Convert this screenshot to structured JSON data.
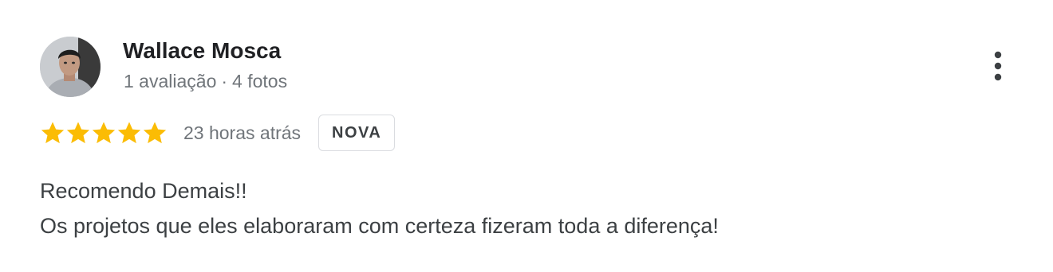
{
  "review": {
    "author": {
      "name": "Wallace Mosca",
      "reviews_count": "1 avaliação",
      "separator": "·",
      "photos_count": "4 fotos",
      "avatar_icon": "person-photo-avatar"
    },
    "menu_icon": "more-vert-icon",
    "rating": 5,
    "max_rating": 5,
    "star_color": "#fbbc04",
    "time": "23 horas atrás",
    "badge": "NOVA",
    "text_lines": [
      "Recomendo Demais!!",
      "Os projetos que eles elaboraram com certeza fizeram toda a diferença!"
    ]
  }
}
